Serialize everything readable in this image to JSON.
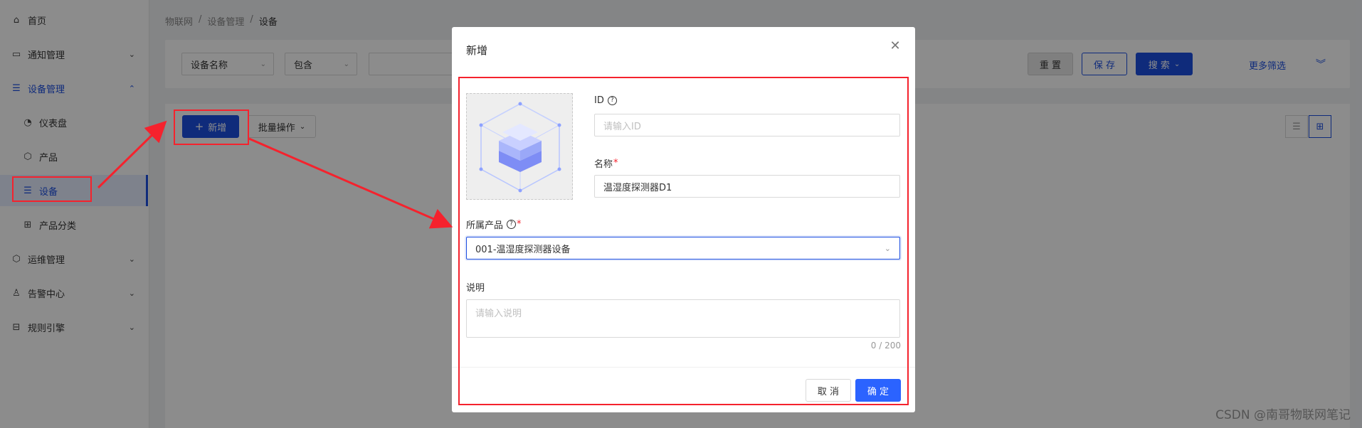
{
  "sidebar": {
    "items": [
      {
        "label": "首页",
        "icon": "home-icon"
      },
      {
        "label": "通知管理",
        "icon": "notification-icon"
      },
      {
        "label": "设备管理",
        "icon": "device-management-icon"
      },
      {
        "label": "仪表盘",
        "icon": "dashboard-icon"
      },
      {
        "label": "产品",
        "icon": "product-icon"
      },
      {
        "label": "设备",
        "icon": "device-icon"
      },
      {
        "label": "产品分类",
        "icon": "category-icon"
      },
      {
        "label": "运维管理",
        "icon": "ops-icon"
      },
      {
        "label": "告警中心",
        "icon": "alarm-icon"
      },
      {
        "label": "规则引擎",
        "icon": "rule-engine-icon"
      }
    ]
  },
  "breadcrumb": {
    "items": [
      "物联网",
      "设备管理",
      "设备"
    ],
    "separator": "/"
  },
  "filter": {
    "field_select": "设备名称",
    "operator_select": "包含",
    "value": "",
    "reset_label": "重 置",
    "save_label": "保 存",
    "search_label": "搜 索",
    "more_filter_label": "更多筛选"
  },
  "toolbar": {
    "add_label": "新增",
    "batch_label": "批量操作"
  },
  "modal": {
    "title": "新增",
    "id_label": "ID",
    "id_placeholder": "请输入ID",
    "name_label": "名称",
    "name_value": "温湿度探测器D1",
    "product_label": "所属产品",
    "product_value": "001-温湿度探测器设备",
    "desc_label": "说明",
    "desc_placeholder": "请输入说明",
    "desc_counter": "0 / 200",
    "cancel_label": "取 消",
    "confirm_label": "确 定"
  },
  "colors": {
    "accent": "#1d4fe0",
    "annotation": "#f5222d"
  },
  "watermark": "CSDN @南哥物联网笔记"
}
